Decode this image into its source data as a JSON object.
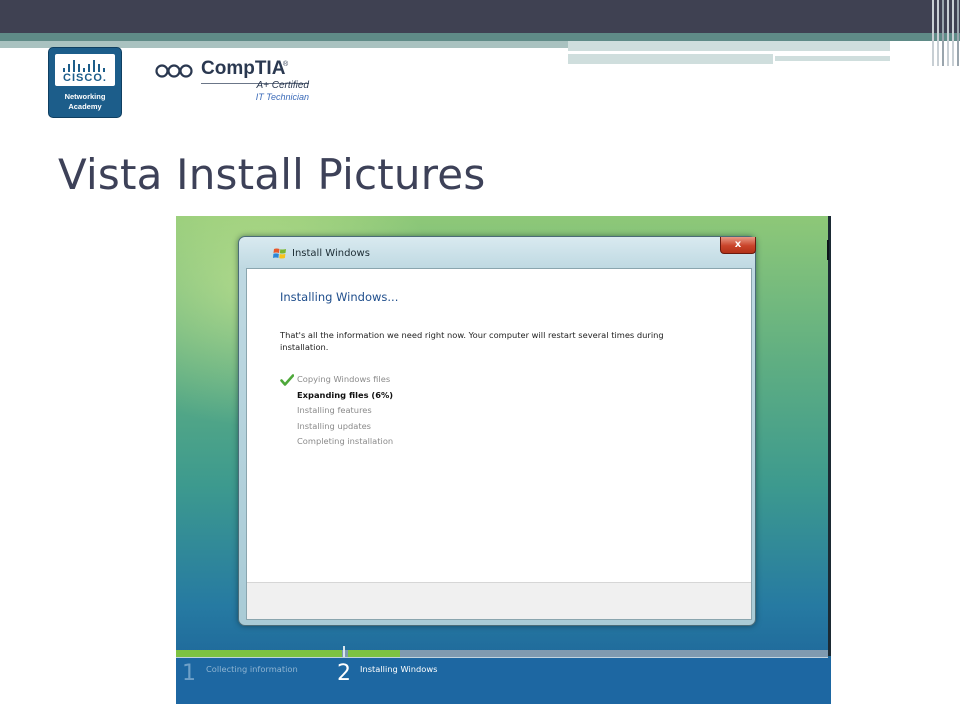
{
  "slide": {
    "title": "Vista Install Pictures"
  },
  "logos": {
    "cisco": {
      "word": "CISCO",
      "sub1": "Networking",
      "sub2": "Academy",
      "dot": "."
    },
    "comptia": {
      "word": "CompTIA",
      "tm": "®",
      "cert": "A+ Certified",
      "tech": "IT Technician"
    }
  },
  "dialog": {
    "title": "Install Windows",
    "close_label": "x",
    "heading": "Installing Windows...",
    "info": "That's all the information we need right now. Your computer will restart several times during installation.",
    "steps": [
      {
        "label": "Copying Windows files",
        "state": "done"
      },
      {
        "label": "Expanding files (6%)",
        "state": "active"
      },
      {
        "label": "Installing features",
        "state": "pending"
      },
      {
        "label": "Installing updates",
        "state": "pending"
      },
      {
        "label": "Completing installation",
        "state": "pending"
      }
    ]
  },
  "progress": {
    "phases": [
      {
        "number": "1",
        "label": "Collecting information",
        "state": "done"
      },
      {
        "number": "2",
        "label": "Installing Windows",
        "state": "active"
      }
    ]
  },
  "colors": {
    "title_text": "#3d4158",
    "heading_blue": "#1f4e8c",
    "progress_green": "#7dc242",
    "vista_bottom_bar": "#1d67a2"
  },
  "icons": {
    "check": "check-icon",
    "windows": "windows-logo-icon",
    "close": "close-icon"
  }
}
